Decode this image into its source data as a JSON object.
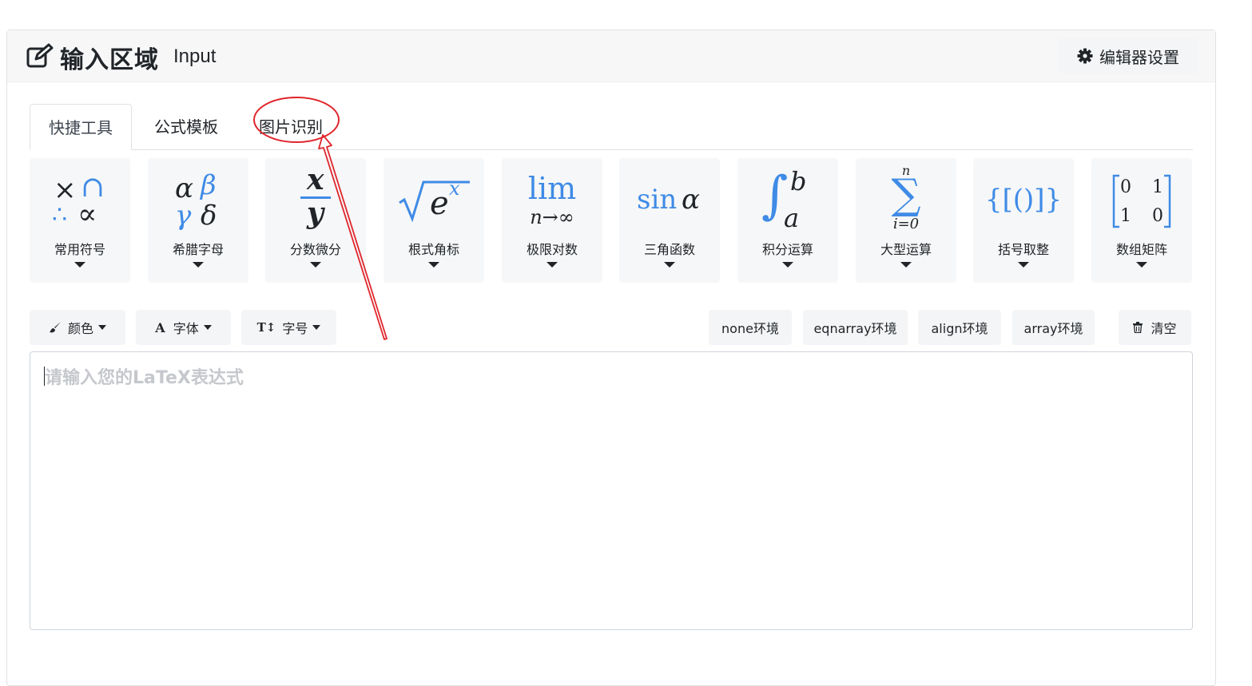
{
  "header": {
    "title": "输入区域",
    "subtitle": "Input",
    "title_icon": "edit-icon",
    "settings_label": "编辑器设置",
    "settings_icon": "gear-icon"
  },
  "tabs": [
    {
      "label": "快捷工具",
      "active": true
    },
    {
      "label": "公式模板",
      "active": false
    },
    {
      "label": "图片识别",
      "active": false
    }
  ],
  "tools": [
    {
      "label": "常用符号"
    },
    {
      "label": "希腊字母"
    },
    {
      "label": "分数微分"
    },
    {
      "label": "根式角标"
    },
    {
      "label": "极限对数"
    },
    {
      "label": "三角函数"
    },
    {
      "label": "积分运算"
    },
    {
      "label": "大型运算"
    },
    {
      "label": "括号取整"
    },
    {
      "label": "数组矩阵"
    }
  ],
  "tool_glyphs": {
    "symbols": {
      "times": "×",
      "cap": "∩",
      "therefore": "∴",
      "propto": "∝"
    },
    "greek": {
      "alpha": "α",
      "beta": "β",
      "gamma": "γ",
      "delta": "δ"
    },
    "fraction": {
      "num": "x",
      "den": "y"
    },
    "root": {
      "radicand": "e",
      "exp": "x"
    },
    "limit": {
      "lim": "lim",
      "sub": "n→∞"
    },
    "trig": {
      "fn": "sin",
      "arg": "α"
    },
    "integral": {
      "sign": "∫",
      "upper": "b",
      "lower": "a"
    },
    "sum": {
      "sign": "∑",
      "upper": "n",
      "lower": "i=0"
    },
    "brackets": "{[()]}",
    "matrix": [
      [
        "0",
        "1"
      ],
      [
        "1",
        "0"
      ]
    ]
  },
  "format_buttons": [
    {
      "label": "颜色",
      "icon": "brush-icon"
    },
    {
      "label": "字体",
      "icon": "font-icon",
      "icon_text": "A"
    },
    {
      "label": "字号",
      "icon": "text-size-icon",
      "icon_text": "T↕"
    }
  ],
  "env_buttons": [
    {
      "label": "none环境"
    },
    {
      "label": "eqnarray环境"
    },
    {
      "label": "align环境"
    },
    {
      "label": "array环境"
    }
  ],
  "clear_button": {
    "label": "清空",
    "icon": "trash-icon"
  },
  "editor": {
    "placeholder": "请输入您的LaTeX表达式",
    "value": ""
  },
  "colors": {
    "accent_blue": "#3f8be6",
    "annotation_red": "#e0262d"
  }
}
